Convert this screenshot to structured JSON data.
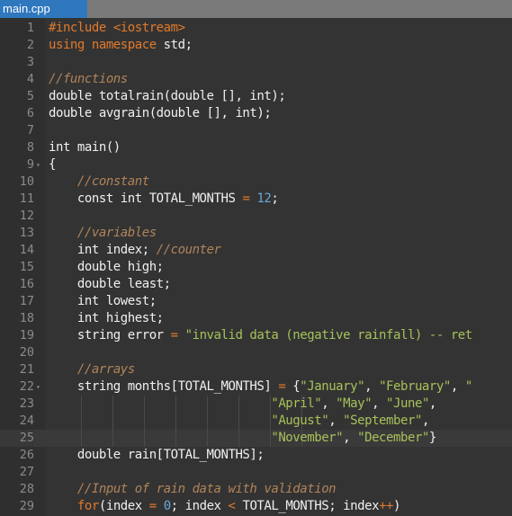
{
  "tab": {
    "filename": "main.cpp"
  },
  "editor": {
    "active_line": 25,
    "colors": {
      "background": "#333333",
      "gutter": "#2f2f2f",
      "keyword": "#e07a2c",
      "comment": "#b0845a",
      "string": "#a6c25a",
      "number": "#6aa7d8",
      "text": "#f0f0f0",
      "tab_active": "#2f78bd"
    },
    "lines": [
      {
        "n": "1",
        "tokens": [
          [
            "kw",
            "#include "
          ],
          [
            "kw",
            "<iostream>"
          ]
        ]
      },
      {
        "n": "2",
        "tokens": [
          [
            "kw",
            "using namespace "
          ],
          [
            "t",
            "std;"
          ]
        ]
      },
      {
        "n": "3",
        "tokens": []
      },
      {
        "n": "4",
        "tokens": [
          [
            "cm",
            "//functions"
          ]
        ]
      },
      {
        "n": "5",
        "tokens": [
          [
            "t",
            "double totalrain(double [], int);"
          ]
        ]
      },
      {
        "n": "6",
        "tokens": [
          [
            "t",
            "double avgrain(double [], int);"
          ]
        ]
      },
      {
        "n": "7",
        "tokens": []
      },
      {
        "n": "8",
        "tokens": [
          [
            "t",
            "int main()"
          ]
        ]
      },
      {
        "n": "9",
        "fold": true,
        "tokens": [
          [
            "t",
            "{"
          ]
        ]
      },
      {
        "n": "10",
        "tokens": [
          [
            "t",
            "    "
          ],
          [
            "cm",
            "//constant"
          ]
        ]
      },
      {
        "n": "11",
        "tokens": [
          [
            "t",
            "    const int TOTAL_MONTHS "
          ],
          [
            "op",
            "="
          ],
          [
            "t",
            " "
          ],
          [
            "num",
            "12"
          ],
          [
            "t",
            ";"
          ]
        ]
      },
      {
        "n": "12",
        "tokens": []
      },
      {
        "n": "13",
        "tokens": [
          [
            "t",
            "    "
          ],
          [
            "cm",
            "//variables"
          ]
        ]
      },
      {
        "n": "14",
        "tokens": [
          [
            "t",
            "    int index; "
          ],
          [
            "cm",
            "//counter"
          ]
        ]
      },
      {
        "n": "15",
        "tokens": [
          [
            "t",
            "    double high;"
          ]
        ]
      },
      {
        "n": "16",
        "tokens": [
          [
            "t",
            "    double least;"
          ]
        ]
      },
      {
        "n": "17",
        "tokens": [
          [
            "t",
            "    int lowest;"
          ]
        ]
      },
      {
        "n": "18",
        "tokens": [
          [
            "t",
            "    int highest;"
          ]
        ]
      },
      {
        "n": "19",
        "tokens": [
          [
            "t",
            "    string error "
          ],
          [
            "op",
            "="
          ],
          [
            "t",
            " "
          ],
          [
            "st",
            "\"invalid data (negative rainfall) -- ret"
          ]
        ]
      },
      {
        "n": "20",
        "tokens": []
      },
      {
        "n": "21",
        "tokens": [
          [
            "t",
            "    "
          ],
          [
            "cm",
            "//arrays"
          ]
        ]
      },
      {
        "n": "22",
        "fold": true,
        "tokens": [
          [
            "t",
            "    string months[TOTAL_MONTHS] "
          ],
          [
            "op",
            "="
          ],
          [
            "t",
            " {"
          ],
          [
            "st",
            "\"January\""
          ],
          [
            "t",
            ", "
          ],
          [
            "st",
            "\"February\""
          ],
          [
            "t",
            ", "
          ],
          [
            "st",
            "\""
          ]
        ]
      },
      {
        "n": "23",
        "guides": true,
        "tokens": [
          [
            "t",
            "                               "
          ],
          [
            "st",
            "\"April\""
          ],
          [
            "t",
            ", "
          ],
          [
            "st",
            "\"May\""
          ],
          [
            "t",
            ", "
          ],
          [
            "st",
            "\"June\""
          ],
          [
            "t",
            ","
          ]
        ]
      },
      {
        "n": "24",
        "guides": true,
        "tokens": [
          [
            "t",
            "                               "
          ],
          [
            "st",
            "\"August\""
          ],
          [
            "t",
            ", "
          ],
          [
            "st",
            "\"September\""
          ],
          [
            "t",
            ","
          ]
        ]
      },
      {
        "n": "25",
        "guides": true,
        "tokens": [
          [
            "t",
            "                               "
          ],
          [
            "st",
            "\"November\""
          ],
          [
            "t",
            ", "
          ],
          [
            "st",
            "\"December\""
          ],
          [
            "t",
            "}"
          ]
        ]
      },
      {
        "n": "26",
        "tokens": [
          [
            "t",
            "    double rain[TOTAL_MONTHS];"
          ]
        ]
      },
      {
        "n": "27",
        "tokens": []
      },
      {
        "n": "28",
        "tokens": [
          [
            "t",
            "    "
          ],
          [
            "cm",
            "//Input of rain data with validation"
          ]
        ]
      },
      {
        "n": "29",
        "tokens": [
          [
            "t",
            "    "
          ],
          [
            "kw",
            "for"
          ],
          [
            "t",
            "(index "
          ],
          [
            "op",
            "="
          ],
          [
            "t",
            " "
          ],
          [
            "num",
            "0"
          ],
          [
            "t",
            "; index "
          ],
          [
            "op",
            "<"
          ],
          [
            "t",
            " TOTAL_MONTHS; index"
          ],
          [
            "op",
            "++"
          ],
          [
            "t",
            ")"
          ]
        ]
      }
    ]
  }
}
